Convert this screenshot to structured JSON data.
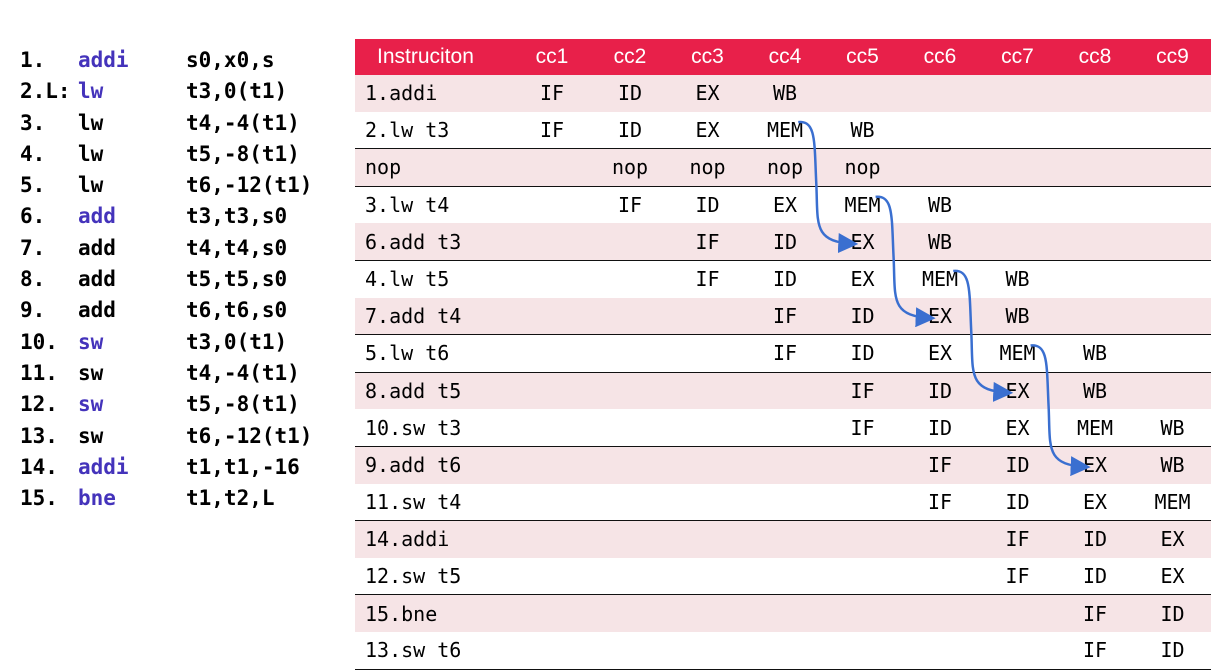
{
  "code_listing": [
    {
      "num": "1.",
      "op": "addi",
      "op_color": "blue",
      "args": "s0,x0,s"
    },
    {
      "num": "2.L:",
      "op": "lw",
      "op_color": "blue",
      "args": "t3,0(t1)"
    },
    {
      "num": "3.",
      "op": "lw",
      "op_color": "black",
      "args": "t4,-4(t1)"
    },
    {
      "num": "4.",
      "op": "lw",
      "op_color": "black",
      "args": "t5,-8(t1)"
    },
    {
      "num": "5.",
      "op": "lw",
      "op_color": "black",
      "args": "t6,-12(t1)"
    },
    {
      "num": "6.",
      "op": "add",
      "op_color": "blue",
      "args": "t3,t3,s0"
    },
    {
      "num": "7.",
      "op": "add",
      "op_color": "black",
      "args": "t4,t4,s0"
    },
    {
      "num": "8.",
      "op": "add",
      "op_color": "black",
      "args": "t5,t5,s0"
    },
    {
      "num": "9.",
      "op": "add",
      "op_color": "black",
      "args": "t6,t6,s0"
    },
    {
      "num": "10.",
      "op": "sw",
      "op_color": "blue",
      "args": "t3,0(t1)"
    },
    {
      "num": "11.",
      "op": "sw",
      "op_color": "black",
      "args": "t4,-4(t1)"
    },
    {
      "num": "12.",
      "op": "sw",
      "op_color": "blue",
      "args": "t5,-8(t1)"
    },
    {
      "num": "13.",
      "op": "sw",
      "op_color": "black",
      "args": "t6,-12(t1)"
    },
    {
      "num": "14.",
      "op": "addi",
      "op_color": "blue",
      "args": "t1,t1,-16"
    },
    {
      "num": "15.",
      "op": "bne",
      "op_color": "blue",
      "args": "t1,t2,L"
    }
  ],
  "pipeline": {
    "headers": [
      "Instruciton",
      "cc1",
      "cc2",
      "cc3",
      "cc4",
      "cc5",
      "cc6",
      "cc7",
      "cc8",
      "cc9"
    ],
    "header_color": "#e8204a",
    "row_shade_color": "#f6e4e6",
    "rows": [
      {
        "instr": "1.addi",
        "cells": [
          "IF",
          "ID",
          "EX",
          "WB",
          "",
          "",
          "",
          "",
          ""
        ]
      },
      {
        "instr": "2.lw t3",
        "cells": [
          "IF",
          "ID",
          "EX",
          "MEM",
          "WB",
          "",
          "",
          "",
          ""
        ]
      },
      {
        "instr": "nop",
        "cells": [
          "",
          "nop",
          "nop",
          "nop",
          "nop",
          "",
          "",
          "",
          ""
        ]
      },
      {
        "instr": "3.lw t4",
        "cells": [
          "",
          "IF",
          "ID",
          "EX",
          "MEM",
          "WB",
          "",
          "",
          ""
        ]
      },
      {
        "instr": "6.add t3",
        "cells": [
          "",
          "",
          "IF",
          "ID",
          "EX",
          "WB",
          "",
          "",
          ""
        ]
      },
      {
        "instr": "4.lw t5",
        "cells": [
          "",
          "",
          "IF",
          "ID",
          "EX",
          "MEM",
          "WB",
          "",
          ""
        ]
      },
      {
        "instr": "7.add t4",
        "cells": [
          "",
          "",
          "",
          "IF",
          "ID",
          "EX",
          "WB",
          "",
          ""
        ]
      },
      {
        "instr": "5.lw t6",
        "cells": [
          "",
          "",
          "",
          "IF",
          "ID",
          "EX",
          "MEM",
          "WB",
          ""
        ]
      },
      {
        "instr": "8.add t5",
        "cells": [
          "",
          "",
          "",
          "",
          "IF",
          "ID",
          "EX",
          "WB",
          ""
        ]
      },
      {
        "instr": "10.sw t3",
        "cells": [
          "",
          "",
          "",
          "",
          "IF",
          "ID",
          "EX",
          "MEM",
          "WB"
        ]
      },
      {
        "instr": "9.add t6",
        "cells": [
          "",
          "",
          "",
          "",
          "",
          "IF",
          "ID",
          "EX",
          "WB"
        ]
      },
      {
        "instr": "11.sw t4",
        "cells": [
          "",
          "",
          "",
          "",
          "",
          "IF",
          "ID",
          "EX",
          "MEM"
        ]
      },
      {
        "instr": "14.addi",
        "cells": [
          "",
          "",
          "",
          "",
          "",
          "",
          "IF",
          "ID",
          "EX"
        ]
      },
      {
        "instr": "12.sw t5",
        "cells": [
          "",
          "",
          "",
          "",
          "",
          "",
          "IF",
          "ID",
          "EX"
        ]
      },
      {
        "instr": "15.bne",
        "cells": [
          "",
          "",
          "",
          "",
          "",
          "",
          "",
          "IF",
          "ID"
        ]
      },
      {
        "instr": "13.sw t6",
        "cells": [
          "",
          "",
          "",
          "",
          "",
          "",
          "",
          "IF",
          "ID"
        ]
      }
    ],
    "forwarding_color": "#3a6fd0",
    "forwarding": [
      {
        "from_row": 1,
        "from_col": 4,
        "to_row": 4,
        "to_col": 5
      },
      {
        "from_row": 3,
        "from_col": 5,
        "to_row": 6,
        "to_col": 6
      },
      {
        "from_row": 5,
        "from_col": 6,
        "to_row": 8,
        "to_col": 7
      },
      {
        "from_row": 7,
        "from_col": 7,
        "to_row": 10,
        "to_col": 8
      }
    ]
  }
}
